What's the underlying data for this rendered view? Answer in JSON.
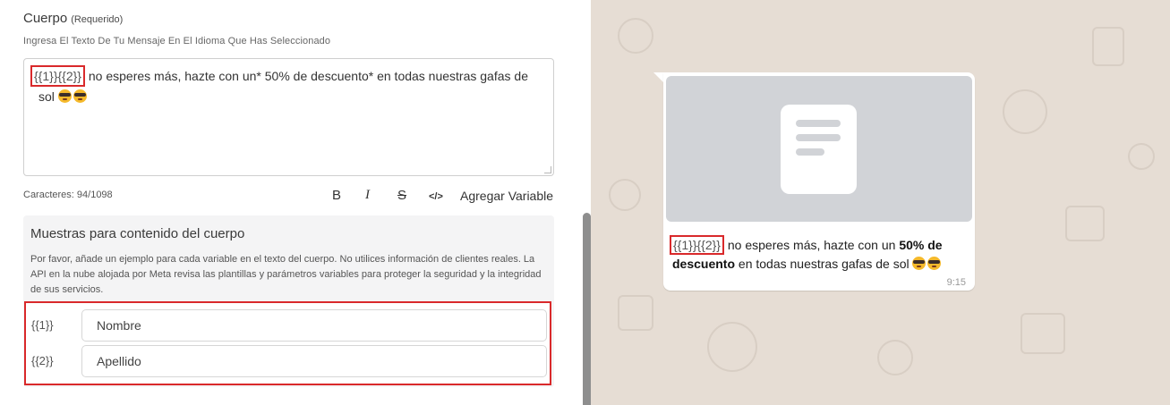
{
  "editor": {
    "title": "Cuerpo",
    "required": "(Requerido)",
    "subtitle": "Ingresa El Texto De Tu Mensaje En El Idioma Que Has Seleccionado",
    "message_vars": "{{1}}{{2}}",
    "message_rest": " no esperes más, hazte con un* 50% de descuento* en todas nuestras gafas de sol",
    "char_counter": "Caracteres: 94/1098",
    "toolbar": {
      "bold": "B",
      "italic": "I",
      "strike": "S",
      "code": "</>",
      "add_variable": "Agregar Variable"
    }
  },
  "samples": {
    "title": "Muestras para contenido del cuerpo",
    "description": "Por favor, añade un ejemplo para cada variable en el texto del cuerpo. No utilices información de clientes reales. La API en la nube alojada por Meta revisa las plantillas y parámetros variables para proteger la seguridad y la integridad de sus servicios.",
    "variables": [
      {
        "label": "{{1}}",
        "value": "Nombre"
      },
      {
        "label": "{{2}}",
        "value": "Apellido"
      }
    ]
  },
  "preview": {
    "vars": "{{1}}{{2}}",
    "text_before_bold": " no esperes más, hazte con un ",
    "bold": "50% de descuento",
    "text_after_bold": " en todas nuestras gafas de sol",
    "time": "9:15"
  },
  "colors": {
    "highlight": "#d9292b",
    "chat_bg": "#e6ddd4",
    "media_placeholder": "#d1d3d7"
  },
  "icons": {
    "emoji": "smiling-face-with-sunglasses",
    "media": "document-icon"
  }
}
